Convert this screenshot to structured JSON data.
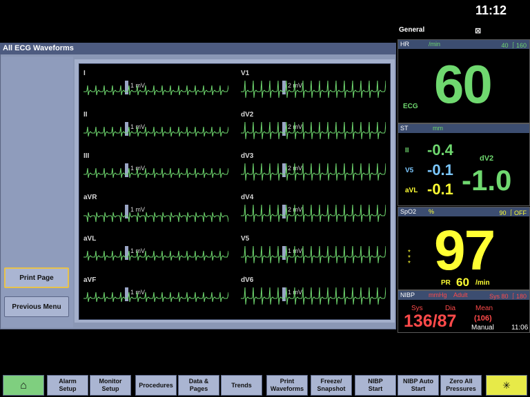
{
  "clock": "11:12",
  "panel": {
    "title": "All ECG Waveforms",
    "print_page": "Print Page",
    "previous_menu": "Previous Menu"
  },
  "leads_left": [
    {
      "name": "I",
      "scale": "1 mV"
    },
    {
      "name": "II",
      "scale": "1 mV"
    },
    {
      "name": "III",
      "scale": "1 mV"
    },
    {
      "name": "aVR",
      "scale": "1 mV"
    },
    {
      "name": "aVL",
      "scale": "1 mV"
    },
    {
      "name": "aVF",
      "scale": "1 mV"
    }
  ],
  "leads_right": [
    {
      "name": "V1",
      "scale": "2 mV"
    },
    {
      "name": "dV2",
      "scale": "2 mV"
    },
    {
      "name": "dV3",
      "scale": "2 mV"
    },
    {
      "name": "dV4",
      "scale": "2 mV"
    },
    {
      "name": "V5",
      "scale": "1 mV"
    },
    {
      "name": "dV6",
      "scale": "1 mV"
    }
  ],
  "general": "General",
  "hr": {
    "label": "HR",
    "unit": "/min",
    "limits": "40 ⎰160",
    "source": "ECG",
    "value": "60"
  },
  "st": {
    "label": "ST",
    "unit": "mm",
    "rows": [
      {
        "lead": "II",
        "value": "-0.4"
      },
      {
        "lead": "V5",
        "value": "-0.1"
      },
      {
        "lead": "aVL",
        "value": "-0.1"
      }
    ],
    "big_lead": "dV2",
    "big_value": "-1.0"
  },
  "spo2": {
    "label": "SpO2",
    "unit": "%",
    "limits": "90 ⎰OFF",
    "value": "97",
    "pr_label": "PR",
    "pr_value": "60",
    "pr_unit": "/min"
  },
  "nibp": {
    "label": "NIBP",
    "unit": "mmHg",
    "mode": "Adult",
    "limits": "Sys 80 ⎰180",
    "sys_label": "Sys",
    "dia_label": "Dia",
    "mean_label": "Mean",
    "value": "136/87",
    "mean": "(106)",
    "manual": "Manual",
    "time": "11:06"
  },
  "footer": [
    {
      "label": "",
      "kind": "home"
    },
    {
      "label": "Alarm\nSetup"
    },
    {
      "label": "Monitor\nSetup"
    },
    {
      "label": "Procedures"
    },
    {
      "label": "Data &\nPages"
    },
    {
      "label": "Trends"
    },
    {
      "label": "Print\nWaveforms"
    },
    {
      "label": "Freeze/\nSnapshot"
    },
    {
      "label": "NIBP\nStart"
    },
    {
      "label": "NIBP Auto\nStart"
    },
    {
      "label": "Zero All\nPressures"
    },
    {
      "label": "",
      "kind": "alarm"
    }
  ],
  "colors": {
    "ecg": "#6fd86f",
    "st": "#7cc8ff",
    "spo2": "#ffff33",
    "nibp": "#ff4a4a"
  }
}
